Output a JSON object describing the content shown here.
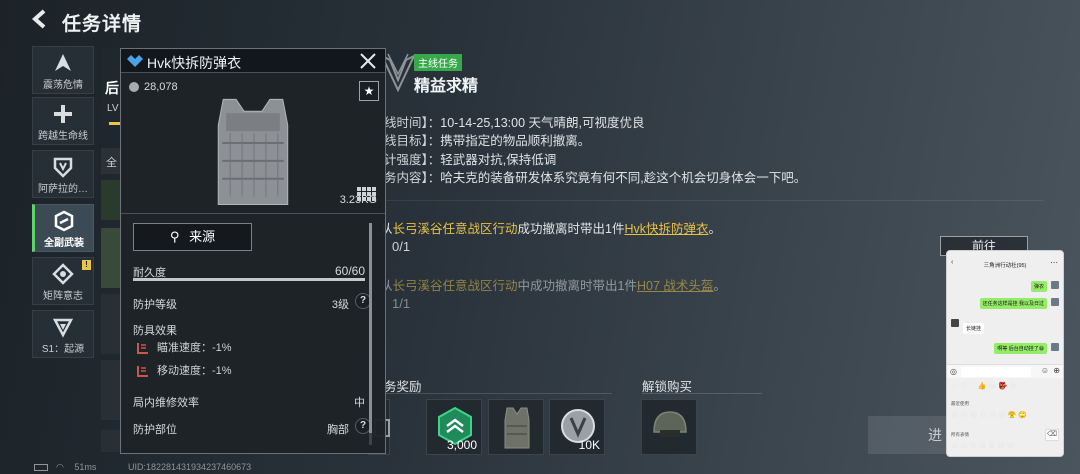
{
  "header": {
    "title": "任务详情",
    "back_icon": "back-arrow-icon"
  },
  "nav": [
    {
      "label": "震荡危情",
      "icon": "quake-icon"
    },
    {
      "label": "跨越生命线",
      "icon": "cross-icon"
    },
    {
      "label": "阿萨拉的…",
      "icon": "shield-icon"
    },
    {
      "label": "全副武装",
      "icon": "armor-icon",
      "active": true
    },
    {
      "label": "矩阵意志",
      "icon": "matrix-icon",
      "badge": "!"
    },
    {
      "label": "S1：起源",
      "icon": "origin-icon"
    }
  ],
  "under_panel": {
    "fragment_a": "后",
    "fragment_b": "LV",
    "fragment_c": "全"
  },
  "popup": {
    "title": "Hvk快拆防弹衣",
    "price": "28,078",
    "weight": "3.23KG",
    "source_button": "来源",
    "durability_label": "耐久度",
    "durability_value": "60/60",
    "durability_fraction": 1.0,
    "protection_label": "防护等级",
    "protection_value": "3级",
    "effects_label": "防具效果",
    "effects": [
      {
        "text": "瞄准速度：-1%"
      },
      {
        "text": "移动速度：-1%"
      }
    ],
    "repair_label": "局内维修效率",
    "repair_value": "中",
    "zone_label": "防护部位",
    "zone_value": "胸部",
    "qmark": "?",
    "star": "★"
  },
  "mission": {
    "tag": "主线任务",
    "name": "精益求精",
    "info": [
      {
        "key": "线时间】：",
        "value": "10-14-25,13:00 天气晴朗,可视度优良"
      },
      {
        "key": "线目标】：",
        "value": "携带指定的物品顺利撤离。"
      },
      {
        "key": "计强度】：",
        "value": "轻武器对抗,保持低调"
      },
      {
        "key": "务内容】：",
        "value": "哈夫克的装备研发体系究竟有何不同,趁这个机会切身体会一下吧。"
      }
    ],
    "objectives": [
      {
        "prefix": "从",
        "place": "长弓溪谷任意战区行动",
        "mid": "成功撤离时带出1件",
        "item": "Hvk快拆防弹衣",
        "suffix": "。",
        "count": "0/1"
      },
      {
        "prefix": "从",
        "place": "长弓溪谷任意战区行动",
        "mid": "中成功撤离时带出1件",
        "item": "H07 战术头盔",
        "suffix": "。",
        "count": "1/1"
      }
    ],
    "goto_button": "前往",
    "rewards_title": "务奖励",
    "unlock_title": "解锁购买",
    "rewards": [
      {
        "name": "reward-emblem",
        "count": ""
      },
      {
        "name": "reward-token",
        "count": "3,000"
      },
      {
        "name": "reward-vest",
        "count": ""
      },
      {
        "name": "reward-coin",
        "count": "10K"
      }
    ],
    "unlock_item": "helmet",
    "next_button": "进"
  },
  "status": {
    "ping": "51ms",
    "uid": "UID:18228143193423746067​3"
  },
  "chat": {
    "title": "三角洲行动社(95)",
    "messages": [
      {
        "who": "me",
        "text": "弹衣"
      },
      {
        "who": "me",
        "text": "还任务这样是挂 我以及日过"
      },
      {
        "who": "them",
        "text": "长链挂"
      },
      {
        "who": "me",
        "text": "啊等 后台自动挂了😄"
      }
    ],
    "emoji_line_1": "☺😊♡👍😂👺😳",
    "section_recent": "最近使用",
    "emoji_line_2": "😀😓😭😆😢😱😤🙄",
    "section_all": "所有表情",
    "emoji_line_3": "😀😃😄😁😆😅😂"
  },
  "colors": {
    "mission_tag": "#38a94b",
    "highlight_text": "#e8c244",
    "nav_active_bar": "#5fd36a",
    "chat_me_bubble": "#95ec69"
  }
}
